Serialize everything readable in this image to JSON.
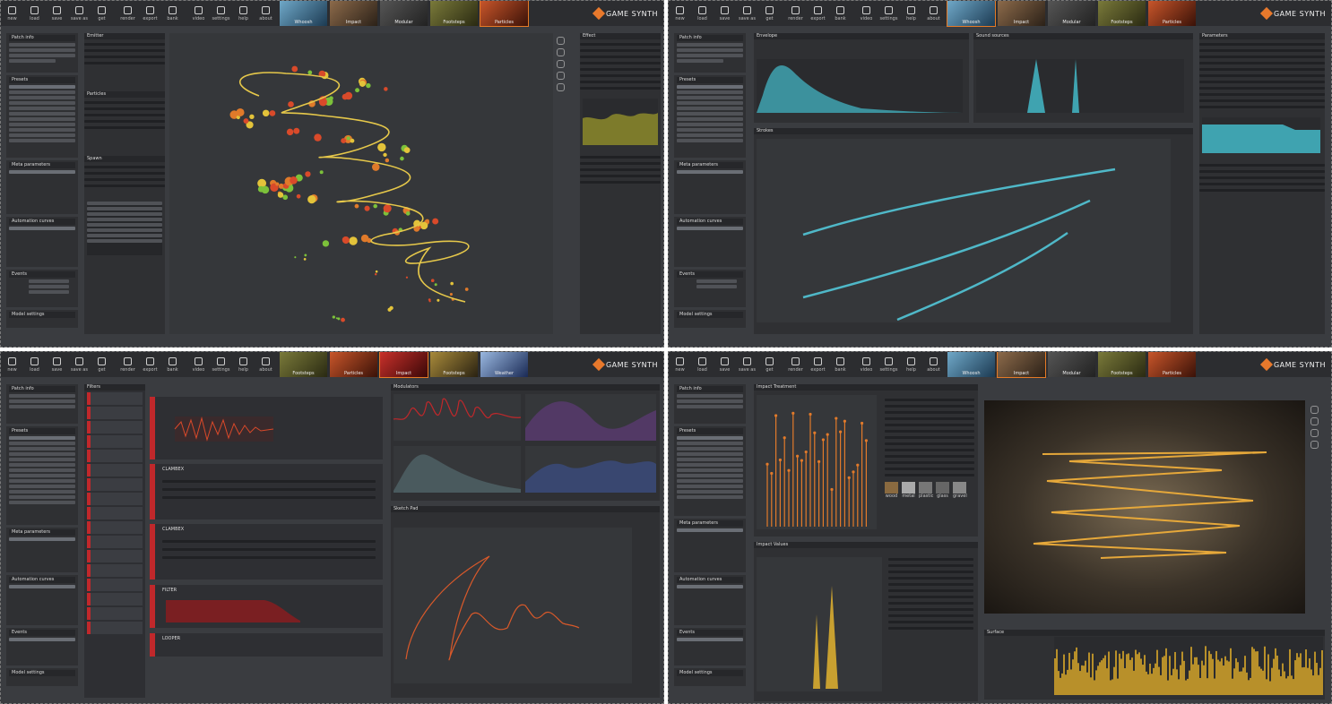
{
  "toolbar": {
    "buttons": [
      "new",
      "load",
      "save",
      "save as",
      "get",
      "render",
      "export",
      "bank",
      "video",
      "settings",
      "help",
      "about"
    ]
  },
  "logo": {
    "text": "GAME SYNTH"
  },
  "q1": {
    "thumbs": [
      "Whoosh",
      "Impact",
      "Modular",
      "Footsteps",
      "Particles"
    ],
    "selected": "Particles",
    "left_panels": [
      "Patch info",
      "Presets",
      "Meta parameters",
      "Automation curves",
      "Events",
      "Model settings"
    ],
    "mid_panels": [
      "Emitter",
      "Particles",
      "Spawn"
    ],
    "right_panels": [
      "Effect"
    ],
    "colors": {
      "stroke": "#e6c84a",
      "accent": "#e57a26",
      "red": "#d94a2a",
      "green": "#7cc13a",
      "yellow": "#e3c33a"
    }
  },
  "q2": {
    "thumbs": [
      "Whoosh",
      "Impact",
      "Modular",
      "Footsteps",
      "Particles"
    ],
    "selected": "Whoosh",
    "panels": [
      "Envelope",
      "Sound sources",
      "Parameters",
      "Strokes"
    ],
    "left_panels": [
      "Patch info",
      "Presets",
      "Meta parameters",
      "Automation curves",
      "Events",
      "Model settings"
    ],
    "colors": {
      "curve": "#4fb8c8",
      "fill": "#3fa3b0"
    }
  },
  "q3": {
    "thumbs": [
      "Footsteps",
      "Particles",
      "Impact",
      "Footsteps",
      "Weather"
    ],
    "selected": "Modular",
    "panels": [
      "Filters",
      "Modulators",
      "Sketch Pad"
    ],
    "modules": [
      "CLAMBEX",
      "CLAMBEX",
      "FILTER",
      "LOOPER"
    ],
    "colors": {
      "mod": "#c0282b",
      "sketch": "#d9592a"
    }
  },
  "q4": {
    "thumbs": [
      "Whoosh",
      "Impact",
      "Modular",
      "Footsteps",
      "Particles"
    ],
    "selected": "Impact",
    "panels": [
      "Impact Treatment",
      "Impact Values",
      "Surface"
    ],
    "materials": [
      "wood",
      "metal",
      "plastic",
      "glass",
      "gravel"
    ],
    "colors": {
      "bars": "#e27a2a",
      "stroke": "#e6a83a"
    }
  }
}
